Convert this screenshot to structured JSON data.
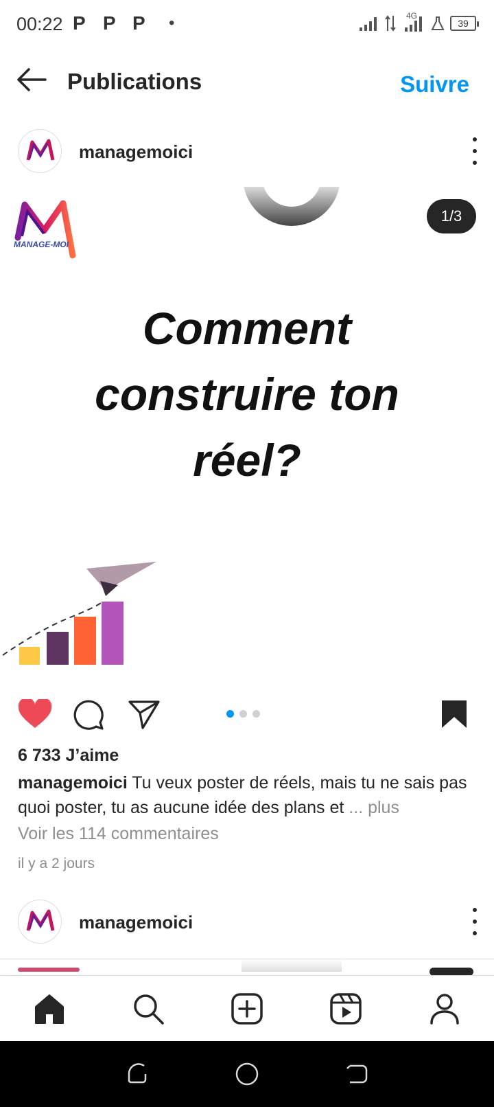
{
  "status_bar": {
    "time": "00:22",
    "notif_1": "P",
    "notif_2": "P",
    "notif_3": "P",
    "dot": "•",
    "network": "4G",
    "battery": "39"
  },
  "header": {
    "title": "Publications",
    "follow_label": "Suivre"
  },
  "post": {
    "username": "managemoici",
    "slide_counter": "1/3",
    "logo_text": "MANAGE-MOI",
    "headline_line1": "Comment",
    "headline_line2": "construire ton",
    "headline_line3": "réel?",
    "likes": "6 733 J’aime",
    "caption_user": "managemoici",
    "caption_text": " Tu veux poster de réels, mais tu ne sais pas quoi poster, tu as aucune idée des plans et ",
    "caption_more": "... plus",
    "comments_link": "Voir les 114 commentaires",
    "time_ago": "il y a 2 jours",
    "carousel_dots": 3,
    "active_dot": 0
  },
  "next_post": {
    "username": "managemoici"
  },
  "bottom_nav": [
    "home-icon",
    "search-icon",
    "add-post-icon",
    "reels-icon",
    "profile-icon"
  ],
  "colors": {
    "accent": "#0095f6",
    "like": "#ed4956",
    "text": "#262626",
    "muted": "#8e8e8e"
  }
}
